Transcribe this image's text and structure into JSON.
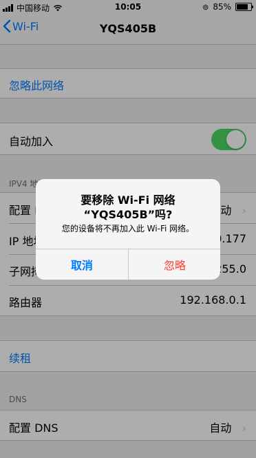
{
  "status": {
    "carrier": "中国移动",
    "time": "10:05",
    "battery": "85%"
  },
  "nav": {
    "back_label": "Wi-Fi",
    "title": "YQS405B"
  },
  "forget_network": "忽略此网络",
  "auto_join": {
    "label": "自动加入",
    "enabled": true
  },
  "ipv4": {
    "header": "IPV4 地址",
    "configure_label": "配置 IP",
    "configure_value": "自动",
    "ip_label": "IP 地址",
    "ip_value": "192.168.0.177",
    "subnet_label": "子网掩码",
    "subnet_value": "255.255.255.0",
    "router_label": "路由器",
    "router_value": "192.168.0.1"
  },
  "renew_lease": "续租",
  "dns": {
    "header": "DNS",
    "configure_label": "配置 DNS",
    "configure_value": "自动"
  },
  "alert": {
    "title_line1": "要移除 Wi-Fi 网络",
    "title_line2": "“YQS405B”吗?",
    "message": "您的设备将不再加入此 Wi-Fi 网络。",
    "cancel_label": "取消",
    "ignore_label": "忽略"
  },
  "colors": {
    "accent": "#007aff",
    "toggle_on": "#4cd964",
    "destructive": "#ff3b30"
  }
}
